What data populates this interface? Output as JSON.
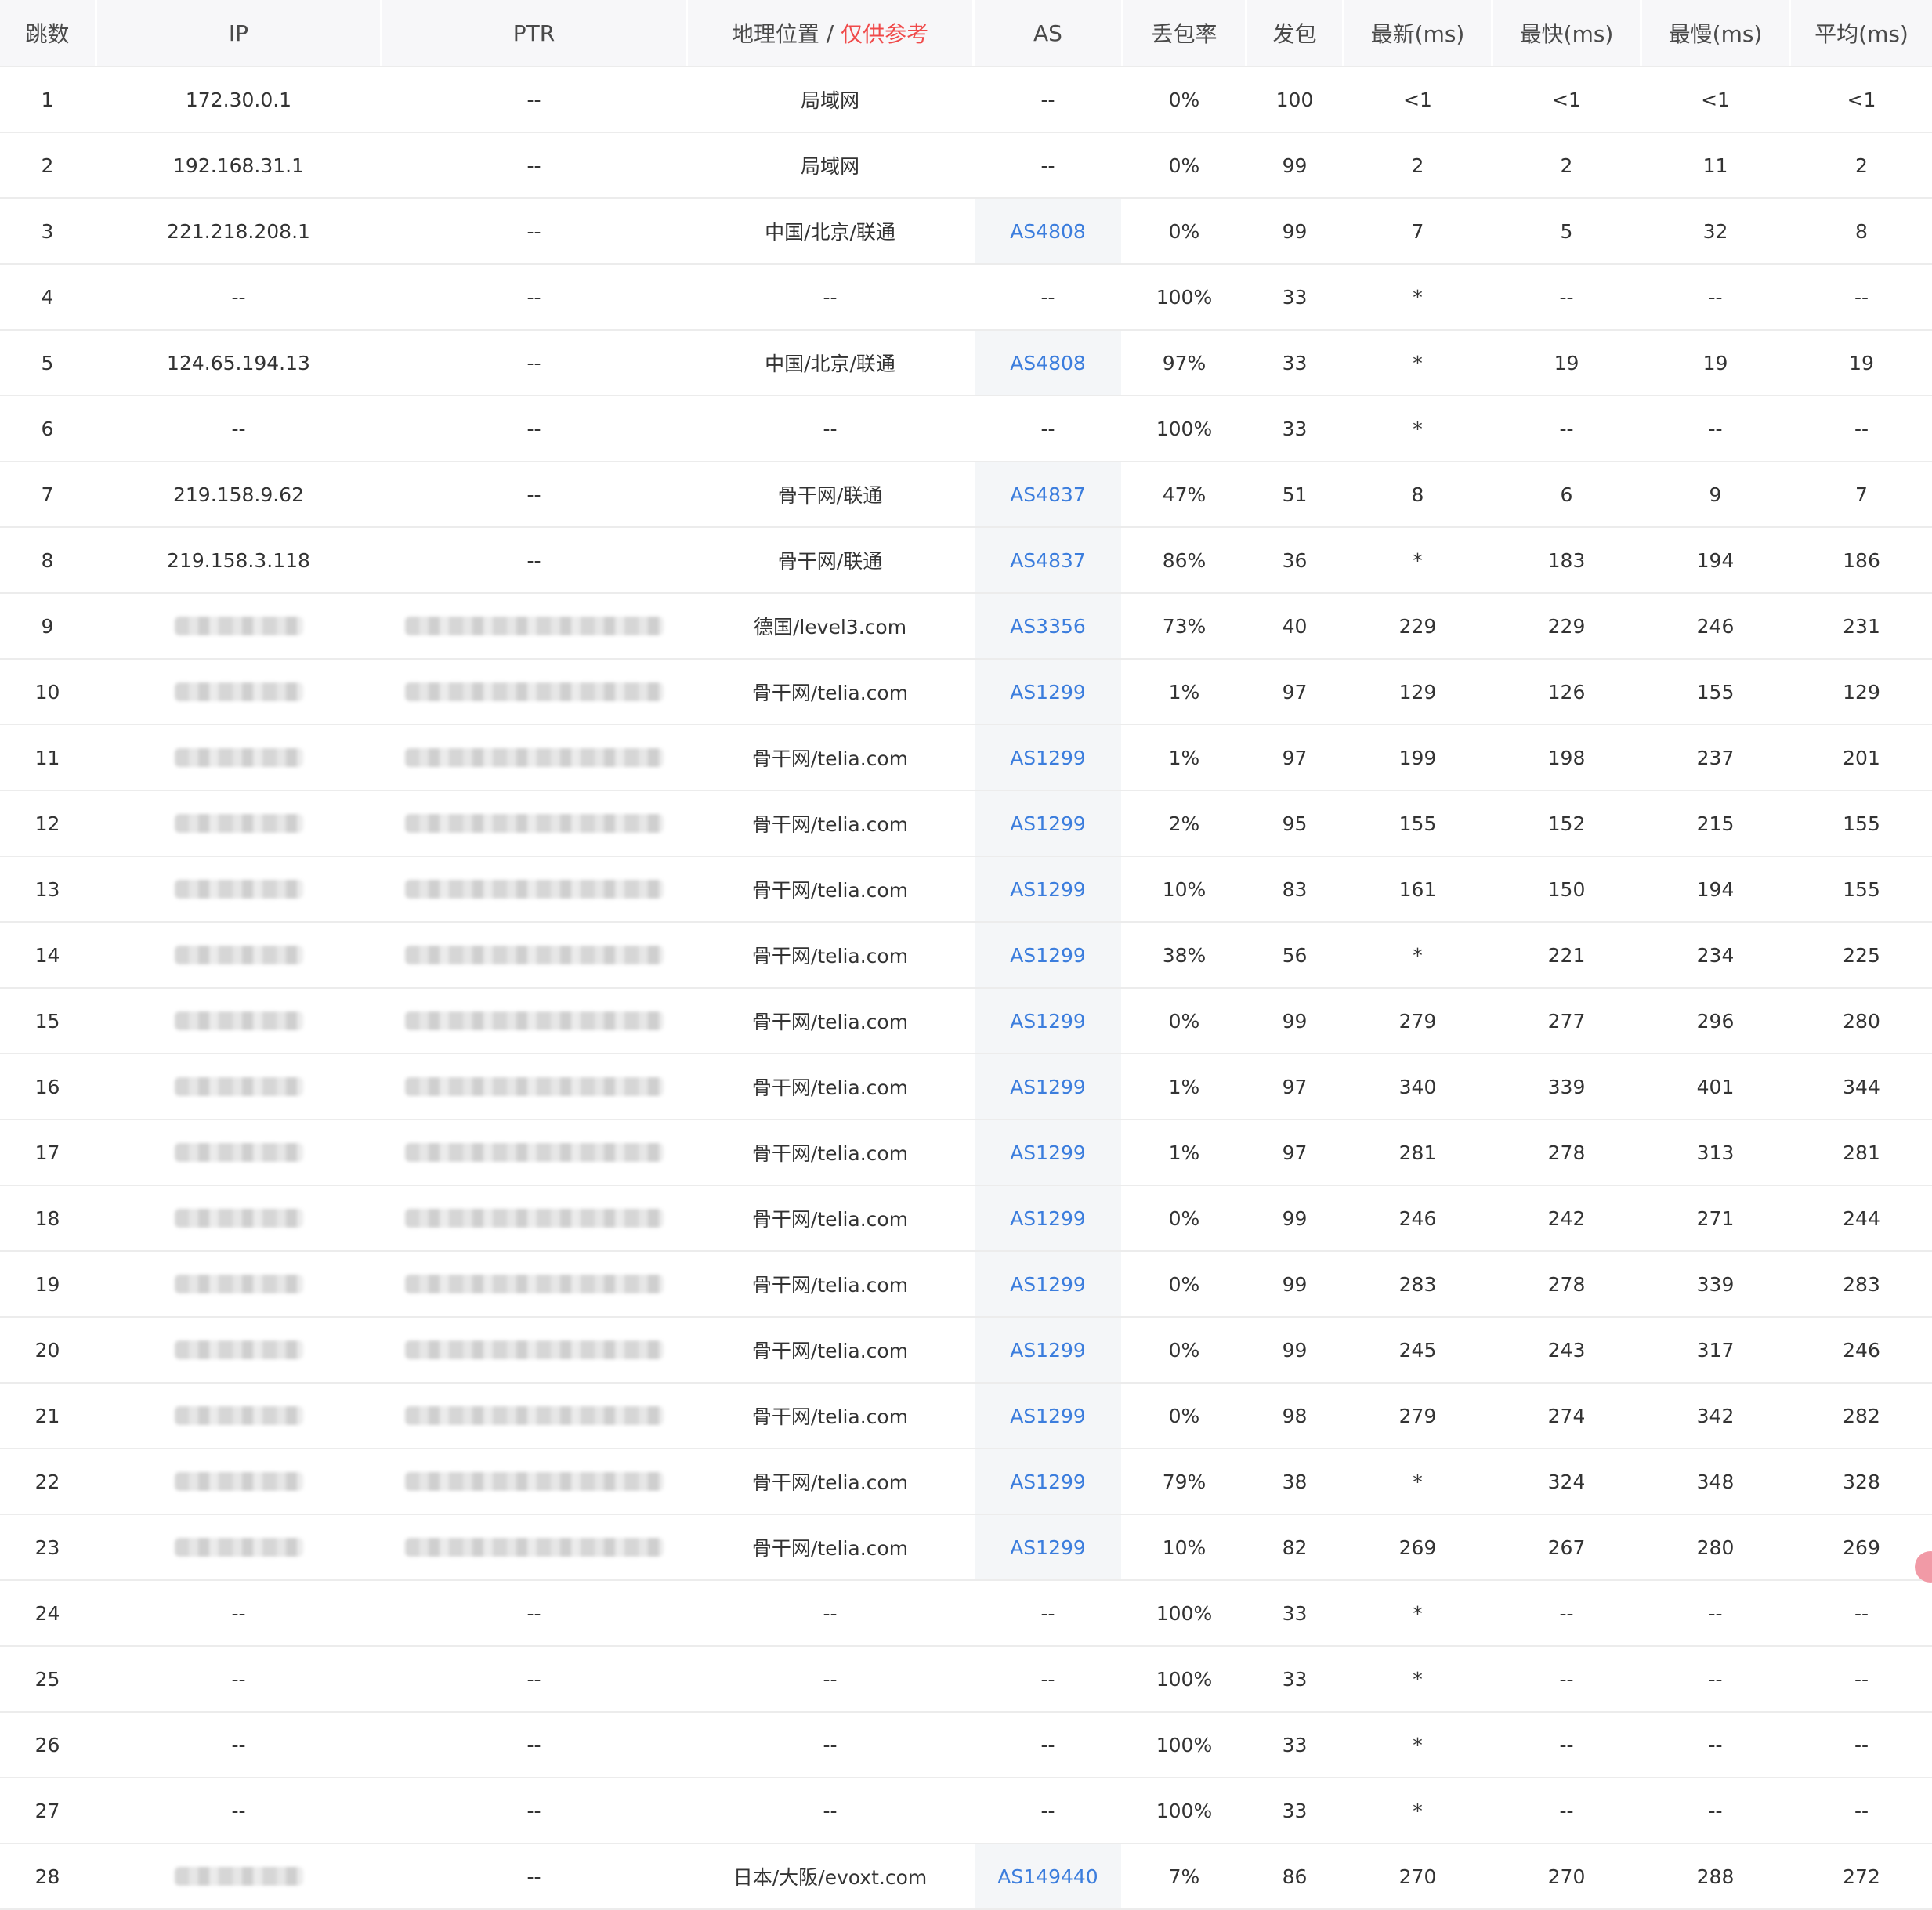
{
  "columns": [
    "跳数",
    "IP",
    "PTR",
    "地理位置",
    "AS",
    "丢包率",
    "发包",
    "最新(ms)",
    "最快(ms)",
    "最慢(ms)",
    "平均(ms)"
  ],
  "geo_header_separator": " / ",
  "geo_header_note": "仅供参考",
  "colors": {
    "as_link": "#3b7ddd",
    "warning": "#f04a4a",
    "header_bg": "#f7f7f9"
  },
  "rows": [
    [
      "1",
      "172.30.0.1",
      "--",
      "局域网",
      "--",
      "0%",
      "100",
      "<1",
      "<1",
      "<1",
      "<1"
    ],
    [
      "2",
      "192.168.31.1",
      "--",
      "局域网",
      "--",
      "0%",
      "99",
      "2",
      "2",
      "11",
      "2"
    ],
    [
      "3",
      "221.218.208.1",
      "--",
      "中国/北京/联通",
      "AS4808",
      "0%",
      "99",
      "7",
      "5",
      "32",
      "8"
    ],
    [
      "4",
      "--",
      "--",
      "--",
      "--",
      "100%",
      "33",
      "*",
      "--",
      "--",
      "--"
    ],
    [
      "5",
      "124.65.194.13",
      "--",
      "中国/北京/联通",
      "AS4808",
      "97%",
      "33",
      "*",
      "19",
      "19",
      "19"
    ],
    [
      "6",
      "--",
      "--",
      "--",
      "--",
      "100%",
      "33",
      "*",
      "--",
      "--",
      "--"
    ],
    [
      "7",
      "219.158.9.62",
      "--",
      "骨干网/联通",
      "AS4837",
      "47%",
      "51",
      "8",
      "6",
      "9",
      "7"
    ],
    [
      "8",
      "219.158.3.118",
      "--",
      "骨干网/联通",
      "AS4837",
      "86%",
      "36",
      "*",
      "183",
      "194",
      "186"
    ],
    [
      "9",
      "",
      "",
      "德国/level3.com",
      "AS3356",
      "73%",
      "40",
      "229",
      "229",
      "246",
      "231"
    ],
    [
      "10",
      "",
      "",
      "骨干网/telia.com",
      "AS1299",
      "1%",
      "97",
      "129",
      "126",
      "155",
      "129"
    ],
    [
      "11",
      "",
      "",
      "骨干网/telia.com",
      "AS1299",
      "1%",
      "97",
      "199",
      "198",
      "237",
      "201"
    ],
    [
      "12",
      "",
      "",
      "骨干网/telia.com",
      "AS1299",
      "2%",
      "95",
      "155",
      "152",
      "215",
      "155"
    ],
    [
      "13",
      "",
      "",
      "骨干网/telia.com",
      "AS1299",
      "10%",
      "83",
      "161",
      "150",
      "194",
      "155"
    ],
    [
      "14",
      "",
      "",
      "骨干网/telia.com",
      "AS1299",
      "38%",
      "56",
      "*",
      "221",
      "234",
      "225"
    ],
    [
      "15",
      "",
      "",
      "骨干网/telia.com",
      "AS1299",
      "0%",
      "99",
      "279",
      "277",
      "296",
      "280"
    ],
    [
      "16",
      "",
      "",
      "骨干网/telia.com",
      "AS1299",
      "1%",
      "97",
      "340",
      "339",
      "401",
      "344"
    ],
    [
      "17",
      "",
      "",
      "骨干网/telia.com",
      "AS1299",
      "1%",
      "97",
      "281",
      "278",
      "313",
      "281"
    ],
    [
      "18",
      "",
      "",
      "骨干网/telia.com",
      "AS1299",
      "0%",
      "99",
      "246",
      "242",
      "271",
      "244"
    ],
    [
      "19",
      "",
      "",
      "骨干网/telia.com",
      "AS1299",
      "0%",
      "99",
      "283",
      "278",
      "339",
      "283"
    ],
    [
      "20",
      "",
      "",
      "骨干网/telia.com",
      "AS1299",
      "0%",
      "99",
      "245",
      "243",
      "317",
      "246"
    ],
    [
      "21",
      "",
      "",
      "骨干网/telia.com",
      "AS1299",
      "0%",
      "98",
      "279",
      "274",
      "342",
      "282"
    ],
    [
      "22",
      "",
      "",
      "骨干网/telia.com",
      "AS1299",
      "79%",
      "38",
      "*",
      "324",
      "348",
      "328"
    ],
    [
      "23",
      "",
      "",
      "骨干网/telia.com",
      "AS1299",
      "10%",
      "82",
      "269",
      "267",
      "280",
      "269"
    ],
    [
      "24",
      "--",
      "--",
      "--",
      "--",
      "100%",
      "33",
      "*",
      "--",
      "--",
      "--"
    ],
    [
      "25",
      "--",
      "--",
      "--",
      "--",
      "100%",
      "33",
      "*",
      "--",
      "--",
      "--"
    ],
    [
      "26",
      "--",
      "--",
      "--",
      "--",
      "100%",
      "33",
      "*",
      "--",
      "--",
      "--"
    ],
    [
      "27",
      "--",
      "--",
      "--",
      "--",
      "100%",
      "33",
      "*",
      "--",
      "--",
      "--"
    ],
    [
      "28",
      "",
      "--",
      "日本/大阪/evoxt.com",
      "AS149440",
      "7%",
      "86",
      "270",
      "270",
      "288",
      "272"
    ]
  ]
}
